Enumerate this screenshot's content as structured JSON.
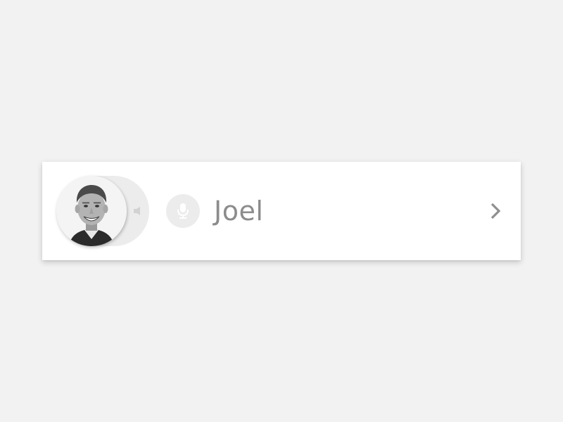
{
  "contact": {
    "name": "Joel"
  },
  "icons": {
    "avatar": "avatar-photo",
    "speaker": "speaker-icon",
    "mic": "microphone-icon",
    "chevron": "chevron-right-icon"
  },
  "colors": {
    "background": "#f2f2f2",
    "card": "#ffffff",
    "name_text": "#8c8c8c",
    "icon_fill": "#cfcfcf",
    "chevron": "#8f8f8f"
  }
}
